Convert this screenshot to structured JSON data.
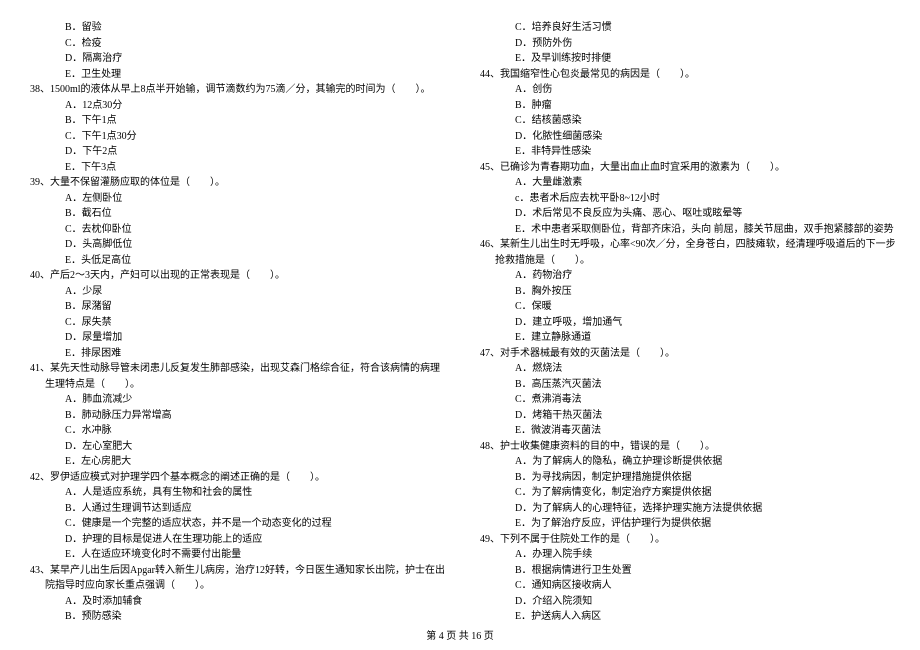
{
  "left": [
    {
      "t": "opt",
      "v": "B．留验"
    },
    {
      "t": "opt",
      "v": "C．检疫"
    },
    {
      "t": "opt",
      "v": "D．隔离治疗"
    },
    {
      "t": "opt",
      "v": "E．卫生处理"
    },
    {
      "t": "q",
      "v": "38、1500ml的液体从早上8点半开始输，调节滴数约为75滴／分，其输完的时间为（　　）。"
    },
    {
      "t": "opt",
      "v": "A．12点30分"
    },
    {
      "t": "opt",
      "v": "B．下午1点"
    },
    {
      "t": "opt",
      "v": "C．下午1点30分"
    },
    {
      "t": "opt",
      "v": "D．下午2点"
    },
    {
      "t": "opt",
      "v": "E．下午3点"
    },
    {
      "t": "q",
      "v": "39、大量不保留灌肠应取的体位是（　　）。"
    },
    {
      "t": "opt",
      "v": "A．左侧卧位"
    },
    {
      "t": "opt",
      "v": "B．截石位"
    },
    {
      "t": "opt",
      "v": "C．去枕仰卧位"
    },
    {
      "t": "opt",
      "v": "D．头高脚低位"
    },
    {
      "t": "opt",
      "v": "E．头低足高位"
    },
    {
      "t": "q",
      "v": "40、产后2～3天内，产妇可以出现的正常表现是（　　）。"
    },
    {
      "t": "opt",
      "v": "A．少尿"
    },
    {
      "t": "opt",
      "v": "B．尿潴留"
    },
    {
      "t": "opt",
      "v": "C．尿失禁"
    },
    {
      "t": "opt",
      "v": "D．尿量增加"
    },
    {
      "t": "opt",
      "v": "E．排尿困难"
    },
    {
      "t": "q",
      "v": "41、某先天性动脉导管未闭患儿反复发生肺部感染，出现艾森门格综合征，符合该病情的病理"
    },
    {
      "t": "cont",
      "v": "生理特点是（　　）。"
    },
    {
      "t": "opt",
      "v": "A．肺血流减少"
    },
    {
      "t": "opt",
      "v": "B．肺动脉压力异常增高"
    },
    {
      "t": "opt",
      "v": "C．水冲脉"
    },
    {
      "t": "opt",
      "v": "D．左心室肥大"
    },
    {
      "t": "opt",
      "v": "E．左心房肥大"
    },
    {
      "t": "q",
      "v": "42、罗伊适应模式对护理学四个基本概念的阐述正确的是（　　）。"
    },
    {
      "t": "opt",
      "v": "A．人是适应系统，具有生物和社会的属性"
    },
    {
      "t": "opt",
      "v": "B．人通过生理调节达到适应"
    },
    {
      "t": "opt",
      "v": "C．健康是一个完整的适应状态，并不是一个动态变化的过程"
    },
    {
      "t": "opt",
      "v": "D．护理的目标是促进人在生理功能上的适应"
    },
    {
      "t": "opt",
      "v": "E．人在适应环境变化时不需要付出能量"
    },
    {
      "t": "q",
      "v": "43、某早产儿出生后因Apgar转入新生儿病房，治疗12好转，今日医生通知家长出院，护士在出"
    },
    {
      "t": "cont",
      "v": "院指导时应向家长重点强调（　　）。"
    },
    {
      "t": "opt",
      "v": "A．及时添加辅食"
    },
    {
      "t": "opt",
      "v": "B．预防感染"
    }
  ],
  "right": [
    {
      "t": "opt",
      "v": "C．培养良好生活习惯"
    },
    {
      "t": "opt",
      "v": "D．预防外伤"
    },
    {
      "t": "opt",
      "v": "E．及早训练按时排便"
    },
    {
      "t": "q",
      "v": "44、我国缩窄性心包炎最常见的病因是（　　）。"
    },
    {
      "t": "opt",
      "v": "A．创伤"
    },
    {
      "t": "opt",
      "v": "B．肿瘤"
    },
    {
      "t": "opt",
      "v": "C．结核菌感染"
    },
    {
      "t": "opt",
      "v": "D．化脓性细菌感染"
    },
    {
      "t": "opt",
      "v": "E．非特异性感染"
    },
    {
      "t": "q",
      "v": "45、已确诊为青春期功血，大量出血止血时宜采用的激素为（　　）。"
    },
    {
      "t": "opt",
      "v": "A．大量雌激素"
    },
    {
      "t": "opt",
      "v": "c．患者术后应去枕平卧8~12小时"
    },
    {
      "t": "opt",
      "v": "D．术后常见不良反应为头痛、恶心、呕吐或眩晕等"
    },
    {
      "t": "opt",
      "v": "E．术中患者采取侧卧位，背部齐床沿，头向 前屈，膝关节屈曲，双手抱紧膝部的姿势"
    },
    {
      "t": "q",
      "v": "46、某新生儿出生时无呼吸，心率<90次／分，全身苍白，四肢瘫软，经清理呼吸道后的下一步"
    },
    {
      "t": "cont",
      "v": "抢救措施是（　　）。"
    },
    {
      "t": "opt",
      "v": "A．药物治疗"
    },
    {
      "t": "opt",
      "v": "B．胸外按压"
    },
    {
      "t": "opt",
      "v": "C．保暖"
    },
    {
      "t": "opt",
      "v": "D．建立呼吸，增加通气"
    },
    {
      "t": "opt",
      "v": "E．建立静脉通道"
    },
    {
      "t": "q",
      "v": "47、对手术器械最有效的灭菌法是（　　）。"
    },
    {
      "t": "opt",
      "v": "A．燃烧法"
    },
    {
      "t": "opt",
      "v": "B．高压蒸汽灭菌法"
    },
    {
      "t": "opt",
      "v": "C．煮沸消毒法"
    },
    {
      "t": "opt",
      "v": "D．烤箱干热灭菌法"
    },
    {
      "t": "opt",
      "v": "E．微波消毒灭菌法"
    },
    {
      "t": "q",
      "v": "48、护士收集健康资料的目的中，错误的是（　　）。"
    },
    {
      "t": "opt",
      "v": "A．为了解病人的隐私，确立护理诊断提供依据"
    },
    {
      "t": "opt",
      "v": "B．为寻找病因，制定护理措施提供依据"
    },
    {
      "t": "opt",
      "v": "C．为了解病情变化，制定治疗方案提供依据"
    },
    {
      "t": "opt",
      "v": "D．为了解病人的心理特征，选择护理实施方法提供依据"
    },
    {
      "t": "opt",
      "v": "E．为了解治疗反应，评估护理行为提供依据"
    },
    {
      "t": "q",
      "v": "49、下列不属于住院处工作的是（　　）。"
    },
    {
      "t": "opt",
      "v": "A．办理入院手续"
    },
    {
      "t": "opt",
      "v": "B．根据病情进行卫生处置"
    },
    {
      "t": "opt",
      "v": "C．通知病区接收病人"
    },
    {
      "t": "opt",
      "v": "D．介绍入院须知"
    },
    {
      "t": "opt",
      "v": "E．护送病人入病区"
    }
  ],
  "footer": "第 4 页 共 16 页"
}
